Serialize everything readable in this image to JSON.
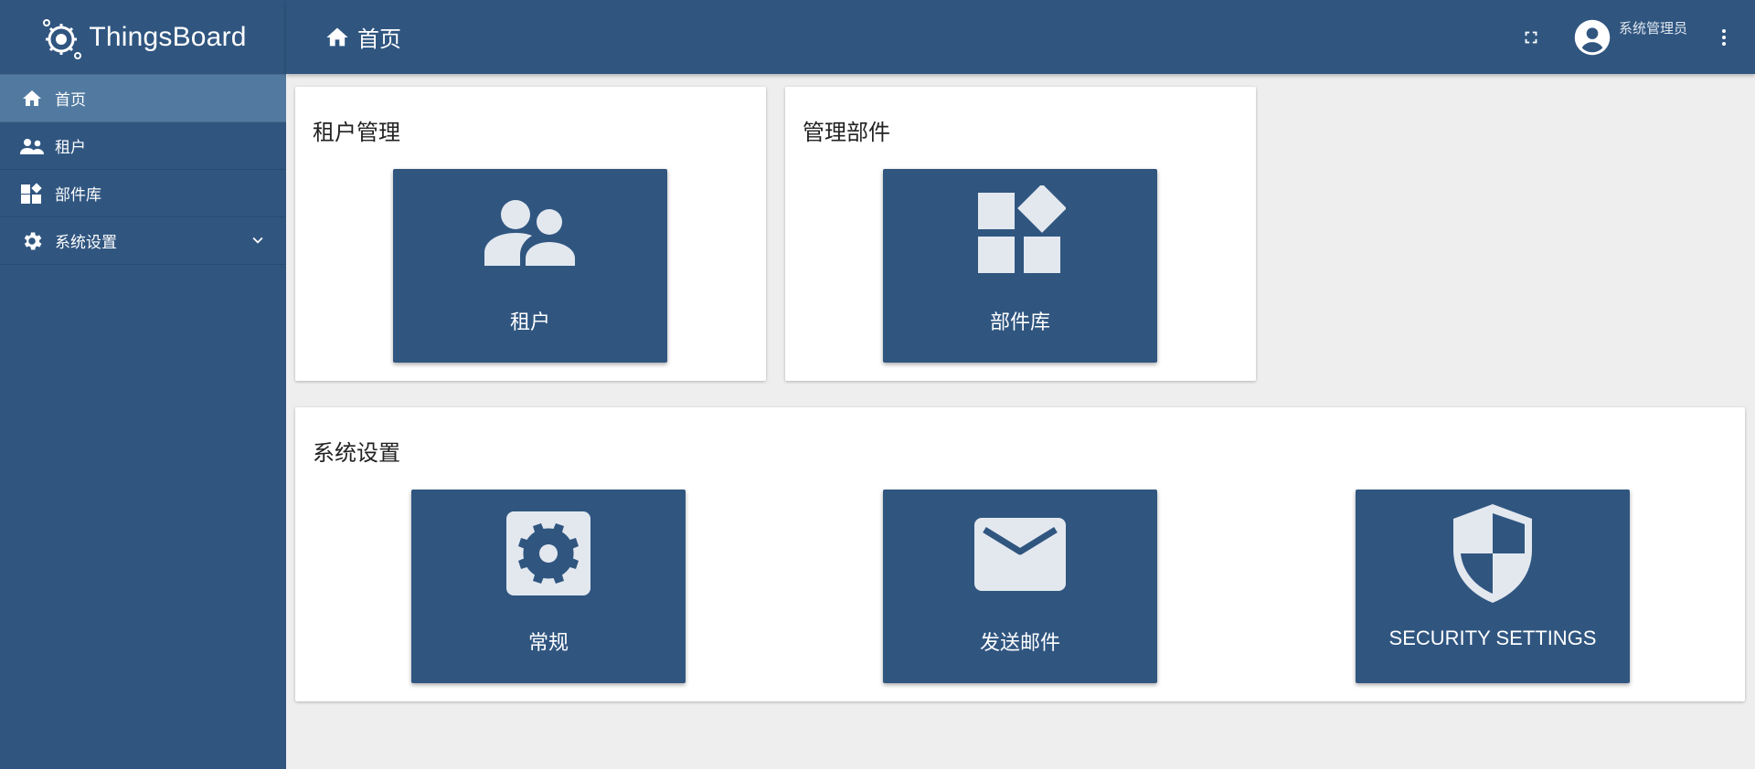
{
  "app": {
    "logo_text": "ThingsBoard"
  },
  "sidebar": {
    "items": [
      {
        "label": "首页",
        "icon": "home-icon"
      },
      {
        "label": "租户",
        "icon": "users-icon"
      },
      {
        "label": "部件库",
        "icon": "widgets-icon"
      },
      {
        "label": "系统设置",
        "icon": "gear-icon"
      }
    ]
  },
  "header": {
    "title": "首页"
  },
  "user": {
    "name": "系统管理员"
  },
  "sections": {
    "tenant": {
      "title": "租户管理",
      "tiles": [
        {
          "label": "租户",
          "icon": "users-icon"
        }
      ]
    },
    "widgets": {
      "title": "管理部件",
      "tiles": [
        {
          "label": "部件库",
          "icon": "widgets-icon"
        }
      ]
    },
    "system": {
      "title": "系统设置",
      "tiles": [
        {
          "label": "常规",
          "icon": "gear-icon"
        },
        {
          "label": "发送邮件",
          "icon": "mail-icon"
        },
        {
          "label": "SECURITY SETTINGS",
          "icon": "shield-icon"
        }
      ]
    }
  },
  "colors": {
    "primary": "#305680",
    "active_nav": "#527aa0",
    "tile_icon": "#e3e8ef",
    "background": "#eeeeee"
  }
}
